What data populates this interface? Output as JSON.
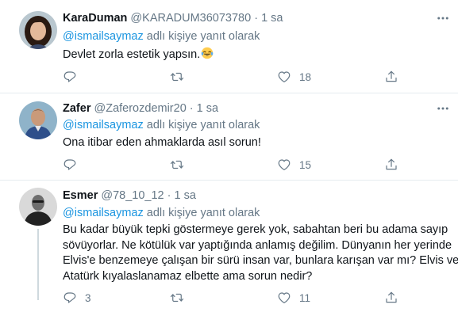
{
  "tweets": [
    {
      "name": "KaraDuman",
      "handle": "@KARADUM36073780",
      "dot": "·",
      "time": "1 sa",
      "reply_prefix": "@ismailsaymaz",
      "reply_suffix": " adlı kişiye yanıt olarak",
      "text_lines": [
        "Devlet zorla estetik yapsın."
      ],
      "emoji": "grinning-tears-emoji",
      "reply_count": "",
      "retweet_count": "",
      "like_count": "18"
    },
    {
      "name": "Zafer",
      "handle": "@Zaferozdemir20",
      "dot": "·",
      "time": "1 sa",
      "reply_prefix": "@ismailsaymaz",
      "reply_suffix": " adlı kişiye yanıt olarak",
      "text_lines": [
        "Ona itibar eden ahmaklarda asıl sorun!"
      ],
      "reply_count": "",
      "retweet_count": "",
      "like_count": "15"
    },
    {
      "name": "Esmer",
      "handle": "@78_10_12",
      "dot": "·",
      "time": "1 sa",
      "reply_prefix": "@ismailsaymaz",
      "reply_suffix": " adlı kişiye yanıt olarak",
      "text_lines": [
        "Bu kadar büyük tepki göstermeye gerek yok, sabahtan beri bu adama sayıp",
        "sövüyorlar. Ne kötülük var yaptığında anlamış değilim. Dünyanın her yerinde",
        "Elvis'e benzemeye çalışan bir sürü insan var, bunlara karışan var mı? Elvis ve",
        "Atatürk kıyalaslanamaz elbette ama sorun nedir?"
      ],
      "reply_count": "3",
      "retweet_count": "",
      "like_count": "11"
    }
  ],
  "icons": {
    "reply": "reply-icon",
    "retweet": "retweet-icon",
    "like": "heart-icon",
    "share": "share-icon"
  },
  "colors": {
    "link": "#1b95e0",
    "secondary": "#657786",
    "border": "#e6ecf0"
  }
}
